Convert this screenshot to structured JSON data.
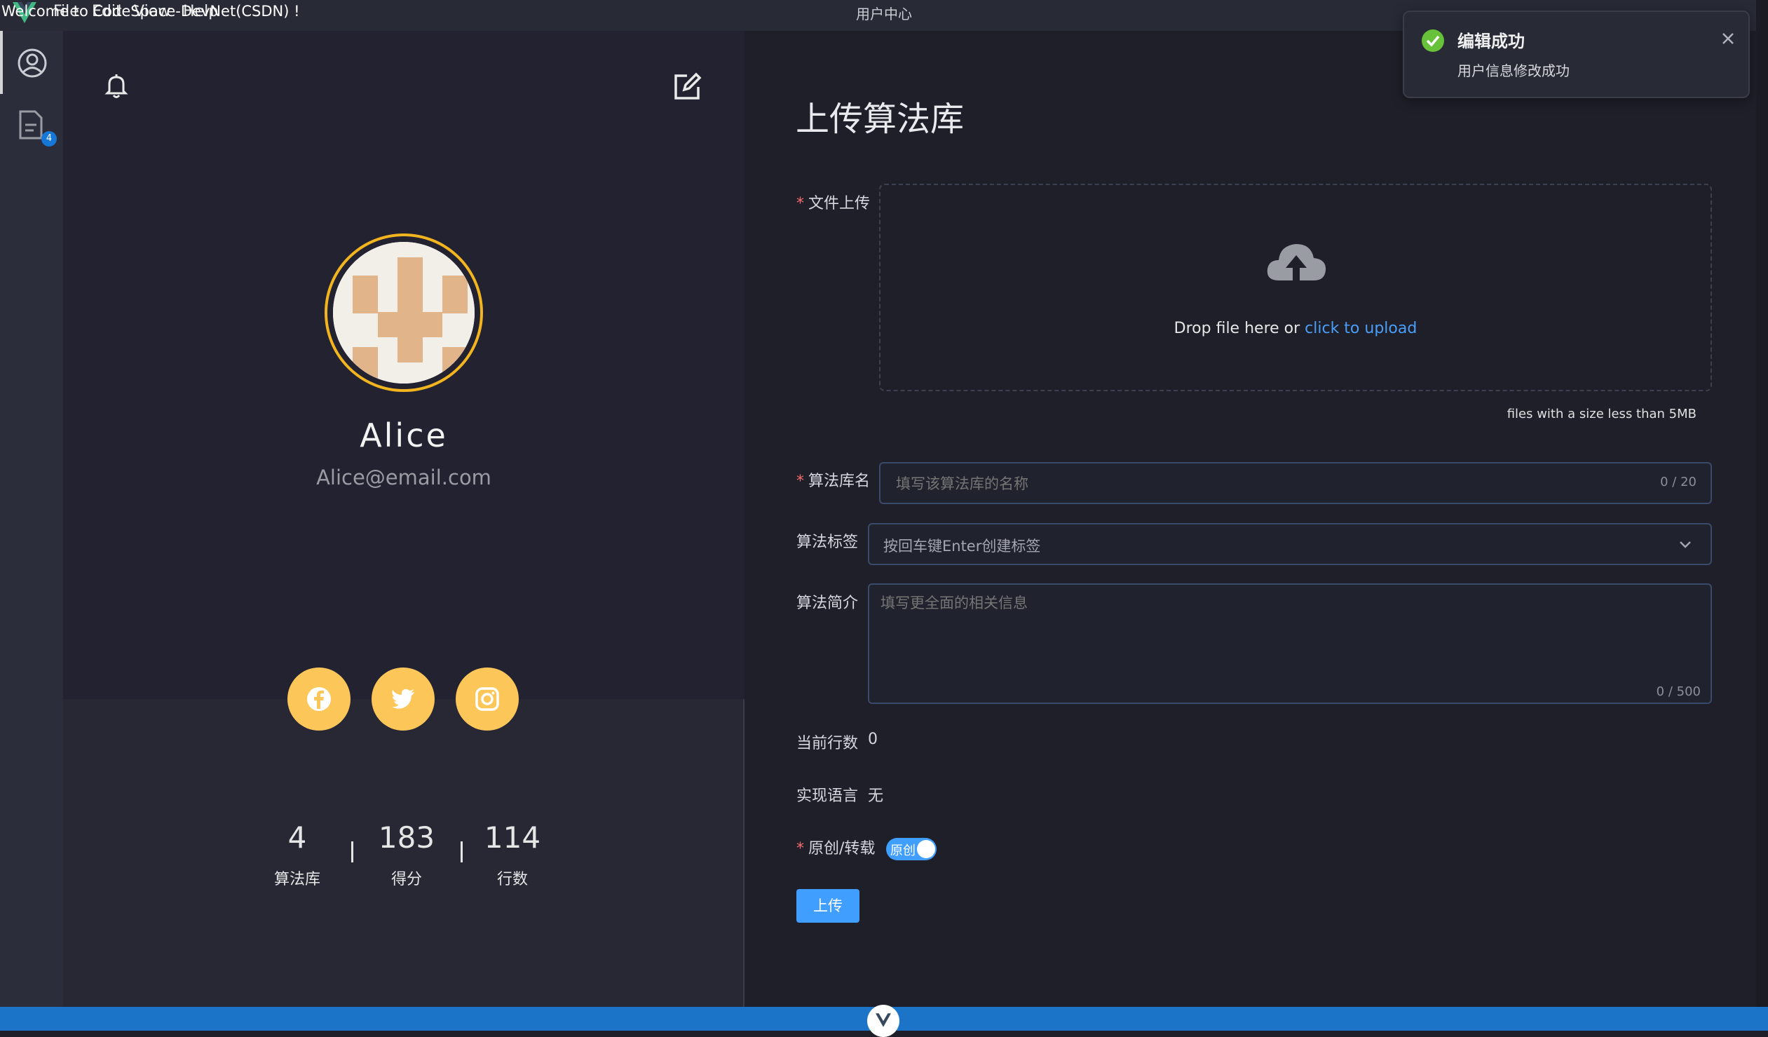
{
  "window": {
    "title": "用户中心",
    "menu": [
      "File",
      "Edit",
      "View",
      "Help"
    ]
  },
  "activity_bar": {
    "items": [
      {
        "name": "profile",
        "icon": "user-circle-icon",
        "active": true
      },
      {
        "name": "documents",
        "icon": "document-icon",
        "badge": "4"
      }
    ]
  },
  "profile": {
    "name": "Alice",
    "email": "Alice@email.com",
    "avatar_border_color": "#f2b41f",
    "social": [
      {
        "icon": "facebook-icon"
      },
      {
        "icon": "twitter-icon"
      },
      {
        "icon": "instagram-icon"
      }
    ],
    "social_color": "#fcc758",
    "stats": [
      {
        "value": "4",
        "label": "算法库"
      },
      {
        "value": "183",
        "label": "得分"
      },
      {
        "value": "114",
        "label": "行数"
      }
    ]
  },
  "form": {
    "title": "上传算法库",
    "file_label": "文件上传",
    "upload_text": "Drop file here or ",
    "upload_link": "click to upload",
    "upload_tip": "files with a size less than 5MB",
    "name_label": "算法库名",
    "name_placeholder": "填写该算法库的名称",
    "name_count": "0 / 20",
    "tag_label": "算法标签",
    "tag_placeholder": "按回车键Enter创建标签",
    "desc_label": "算法简介",
    "desc_placeholder": "填写更全面的相关信息",
    "desc_count": "0 / 500",
    "lines_label": "当前行数",
    "lines_value": "0",
    "lang_label": "实现语言",
    "lang_value": "无",
    "original_label": "原创/转载",
    "original_toggle": "原创",
    "submit_label": "上传",
    "accent_color": "#409eff"
  },
  "notification": {
    "title": "编辑成功",
    "message": "用户信息修改成功",
    "type": "success"
  },
  "status_bar": {
    "text": "Welcome to CodeSpace-DevNet(CSDN) !"
  }
}
